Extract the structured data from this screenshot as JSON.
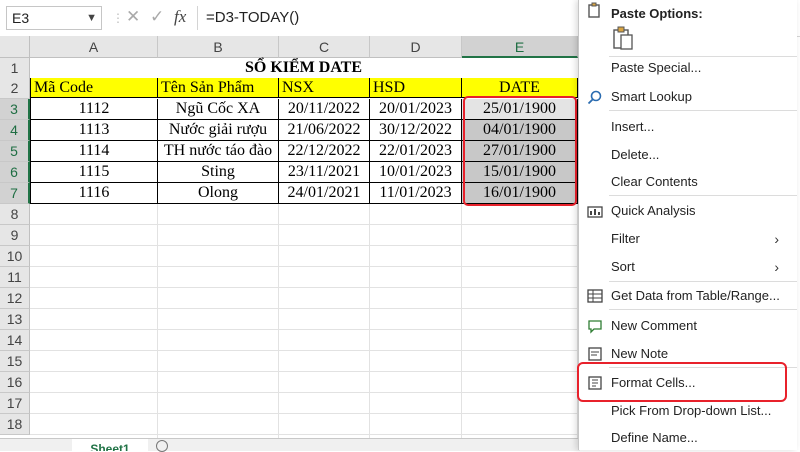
{
  "formula_bar": {
    "name_box": "E3",
    "formula": "=D3-TODAY()",
    "cancel_glyph": "✕",
    "enter_glyph": "✓",
    "fx_label": "fx"
  },
  "columns": [
    "A",
    "B",
    "C",
    "D",
    "E"
  ],
  "rows": [
    "1",
    "2",
    "3",
    "4",
    "5",
    "6",
    "7",
    "8",
    "9",
    "10",
    "11",
    "12",
    "13",
    "14",
    "15",
    "16",
    "17",
    "18"
  ],
  "sheet": {
    "title": "SỔ KIỂM DATE",
    "headers": [
      "Mã Code",
      "Tên Sản Phẩm",
      "NSX",
      "HSD",
      "DATE"
    ],
    "data": [
      [
        "1112",
        "Ngũ Cốc XA",
        "20/11/2022",
        "20/01/2023",
        "25/01/1900"
      ],
      [
        "1113",
        "Nước giải rượu",
        "21/06/2022",
        "30/12/2022",
        "04/01/1900"
      ],
      [
        "1114",
        "TH nước táo đào",
        "22/12/2022",
        "22/01/2023",
        "27/01/1900"
      ],
      [
        "1115",
        "Sting",
        "23/11/2021",
        "10/01/2023",
        "15/01/1900"
      ],
      [
        "1116",
        "Olong",
        "24/01/2021",
        "11/01/2023",
        "16/01/1900"
      ]
    ]
  },
  "sheet_tab": "Sheet1",
  "context_menu": {
    "paste_options": "Paste Options:",
    "items": [
      "Paste Special...",
      "Smart Lookup",
      "Insert...",
      "Delete...",
      "Clear Contents",
      "Quick Analysis",
      "Filter",
      "Sort",
      "Get Data from Table/Range...",
      "New Comment",
      "New Note",
      "Format Cells...",
      "Pick From Drop-down List...",
      "Define Name..."
    ]
  },
  "colors": {
    "accent_green": "#217346",
    "header_fill": "#ffff00",
    "highlight_red": "#e8212b",
    "selected_fill": "#c8c8c8"
  }
}
